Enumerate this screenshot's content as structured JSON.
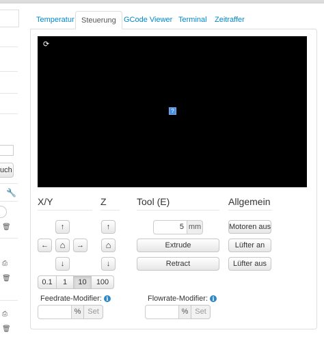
{
  "tabs": [
    {
      "label": "Temperatur",
      "active": false
    },
    {
      "label": "Steuerung",
      "active": true
    },
    {
      "label": "GCode Viewer",
      "active": false
    },
    {
      "label": "Terminal",
      "active": false
    },
    {
      "label": "Zeitraffer",
      "active": false
    }
  ],
  "sidebar": {
    "button_partial_label": "uch",
    "icons": {
      "wrench": "wrench-icon",
      "trash": "trash-icon",
      "print": "print-icon"
    }
  },
  "webcam": {
    "refresh_icon": "refresh-icon",
    "image_icon": "broken-image-icon",
    "image_glyph": "?"
  },
  "sections": {
    "xy": "X/Y",
    "z": "Z",
    "tool": "Tool (E)",
    "general": "Allgemein"
  },
  "jog": {
    "up": "↑",
    "down": "↓",
    "left": "←",
    "right": "→",
    "home": "⌂",
    "step_sizes": [
      "0.1",
      "1",
      "10",
      "100"
    ],
    "active_step": "10"
  },
  "tool": {
    "amount_value": "5",
    "amount_unit": "mm",
    "extrude_label": "Extrude",
    "retract_label": "Retract"
  },
  "general": {
    "motors_off_label": "Motoren aus",
    "fan_on_label": "Lüfter an",
    "fan_off_label": "Lüfter aus"
  },
  "feedrate": {
    "label": "Feedrate-Modifier:",
    "unit": "%",
    "set_label": "Set",
    "value": ""
  },
  "flowrate": {
    "label": "Flowrate-Modifier:",
    "unit": "%",
    "set_label": "Set",
    "value": ""
  },
  "colors": {
    "link": "#0088cc",
    "info": "#2e88c5",
    "webcam_bg": "#000000"
  }
}
